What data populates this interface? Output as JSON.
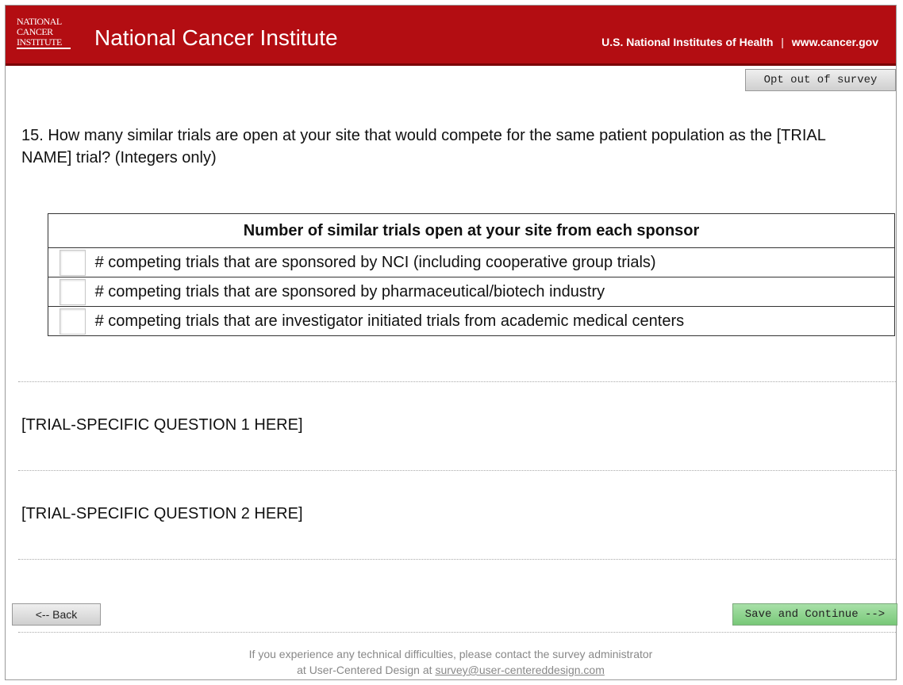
{
  "header": {
    "logo_lines": [
      "NATIONAL",
      "CANCER",
      "INSTITUTE"
    ],
    "brand": "National Cancer Institute",
    "nih": "U.S. National Institutes of Health",
    "separator": "|",
    "site": "www.cancer.gov",
    "bg_color": "#b30d12"
  },
  "toolbar": {
    "opt_out_label": "Opt out of survey"
  },
  "question": {
    "text": "15. How many similar trials are open at your site that would compete for the same patient population as the [TRIAL NAME] trial? (Integers only)"
  },
  "sponsor_table": {
    "header": "Number of similar trials open at your site from each sponsor",
    "rows": [
      {
        "label": "# competing trials that are sponsored by NCI (including cooperative group trials)",
        "value": ""
      },
      {
        "label": "# competing trials that are sponsored by pharmaceutical/biotech industry",
        "value": ""
      },
      {
        "label": "# competing trials that are investigator initiated trials from academic medical centers",
        "value": ""
      }
    ]
  },
  "placeholders": {
    "q1": "[TRIAL-SPECIFIC QUESTION 1 HERE]",
    "q2": "[TRIAL-SPECIFIC QUESTION 2 HERE]"
  },
  "nav": {
    "back_label": "<-- Back",
    "save_label": "Save and Continue -->",
    "save_color": "#78c878"
  },
  "footer": {
    "line1": "If you experience any technical difficulties, please contact the survey administrator",
    "line2_prefix": "at User-Centered Design at",
    "email": "survey@user-centereddesign.com"
  }
}
